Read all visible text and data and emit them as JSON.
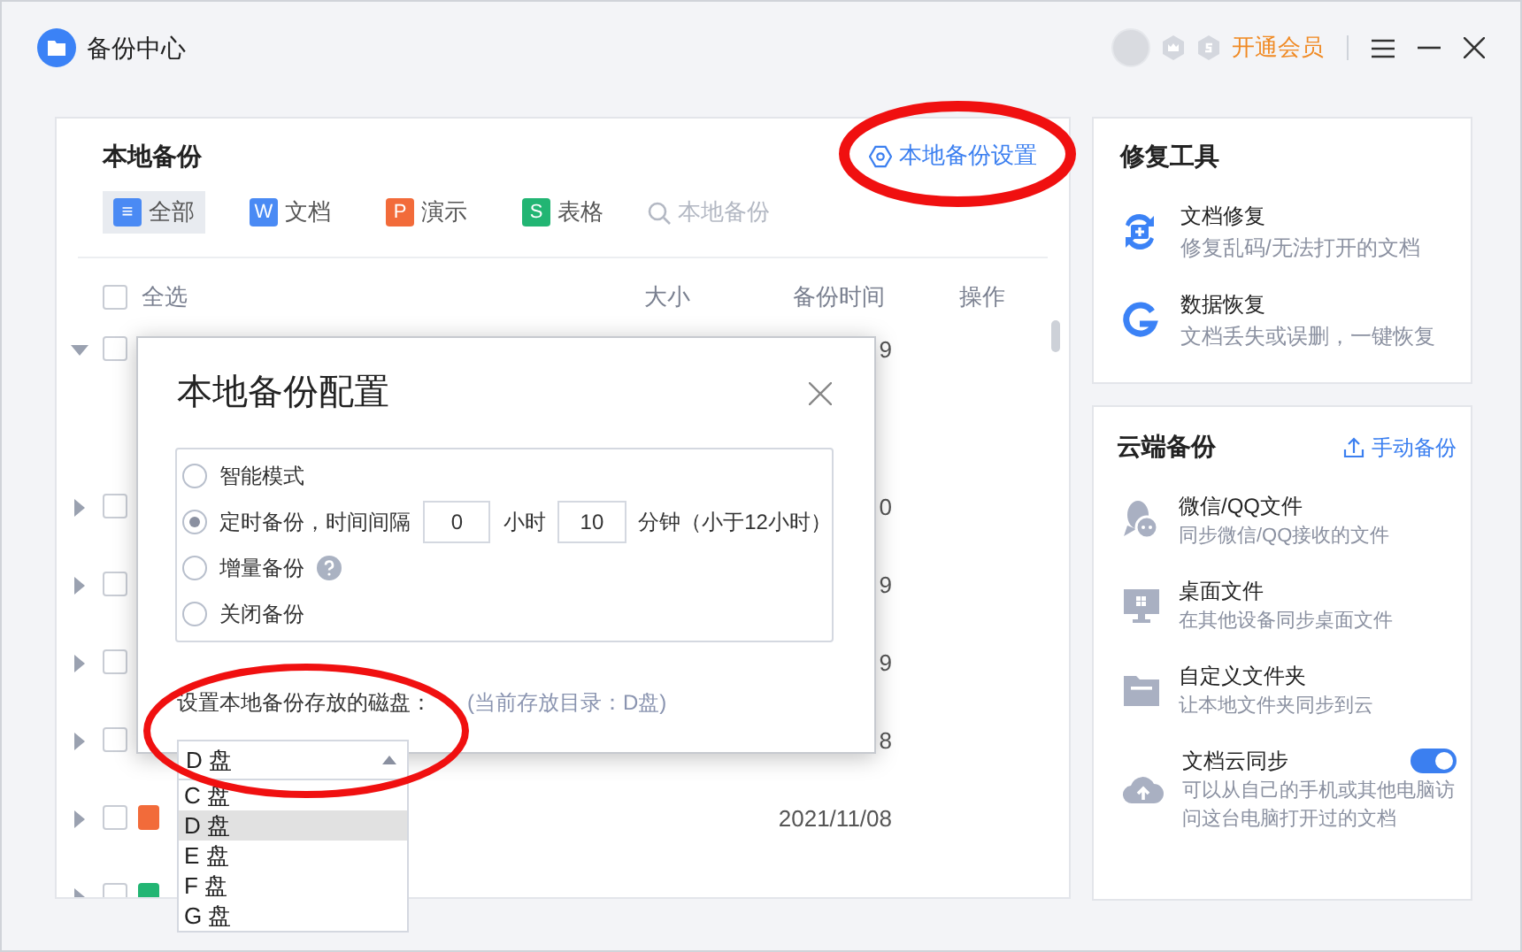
{
  "window": {
    "title": "备份中心",
    "vip": "开通会员"
  },
  "local": {
    "title": "本地备份",
    "settings_link": "本地备份设置",
    "filters": [
      {
        "label": "全部",
        "icon": "≡",
        "color": "#4a8af4",
        "selected": true
      },
      {
        "label": "文档",
        "icon": "W",
        "color": "#4a8af4",
        "selected": false
      },
      {
        "label": "演示",
        "icon": "P",
        "color": "#f26b3a",
        "selected": false
      },
      {
        "label": "表格",
        "icon": "S",
        "color": "#22b573",
        "selected": false
      }
    ],
    "search_placeholder": "本地备份",
    "columns": {
      "select_all": "全选",
      "size": "大小",
      "time": "备份时间",
      "action": "操作"
    },
    "select_all_checked": false,
    "rows": [
      {
        "expanded": true,
        "checked": false,
        "time": "9"
      },
      {
        "expanded": false,
        "checked": false,
        "time": "0"
      },
      {
        "expanded": false,
        "checked": false,
        "time": "9"
      },
      {
        "expanded": false,
        "checked": false,
        "time": "9"
      },
      {
        "expanded": false,
        "checked": false,
        "time": "8"
      },
      {
        "expanded": false,
        "checked": false,
        "time": "2021/11/08",
        "color": "#f26b3a"
      },
      {
        "expanded": false,
        "checked": false,
        "color": "#22b573"
      }
    ]
  },
  "dialog": {
    "title": "本地备份配置",
    "modes": [
      {
        "kind": "plain",
        "label": "智能模式",
        "selected": false
      },
      {
        "kind": "timer",
        "label": "定时备份，时间间隔",
        "hours": "0",
        "hours_unit": "小时",
        "minutes": "10",
        "minutes_unit": "分钟（小于12小时）",
        "selected": true
      },
      {
        "kind": "help",
        "label": "增量备份",
        "selected": false
      },
      {
        "kind": "plain",
        "label": "关闭备份",
        "selected": false
      }
    ],
    "disk_label": "设置本地备份存放的磁盘：",
    "disk_hint": "(当前存放目录：D盘)",
    "disk_value": "D 盘",
    "disk_options": [
      {
        "label": "C 盘",
        "selected": false
      },
      {
        "label": "D 盘",
        "selected": true
      },
      {
        "label": "E 盘",
        "selected": false
      },
      {
        "label": "F 盘",
        "selected": false
      },
      {
        "label": "G 盘",
        "selected": false
      }
    ]
  },
  "repair": {
    "title": "修复工具",
    "items": [
      {
        "kind": "repair",
        "name": "文档修复",
        "desc": "修复乱码/无法打开的文档"
      },
      {
        "kind": "recover",
        "name": "数据恢复",
        "desc": "文档丢失或误删，一键恢复"
      }
    ]
  },
  "cloud": {
    "title": "云端备份",
    "action": "手动备份",
    "items": [
      {
        "kind": "chat",
        "name": "微信/QQ文件",
        "desc": "同步微信/QQ接收的文件"
      },
      {
        "kind": "monitor",
        "name": "桌面文件",
        "desc": "在其他设备同步桌面文件"
      },
      {
        "kind": "folder",
        "name": "自定义文件夹",
        "desc": "让本地文件夹同步到云"
      },
      {
        "kind": "cloud",
        "name": "文档云同步",
        "desc": "可以从自己的手机或其他电脑访问这台电脑打开过的文档",
        "on": true
      }
    ]
  }
}
